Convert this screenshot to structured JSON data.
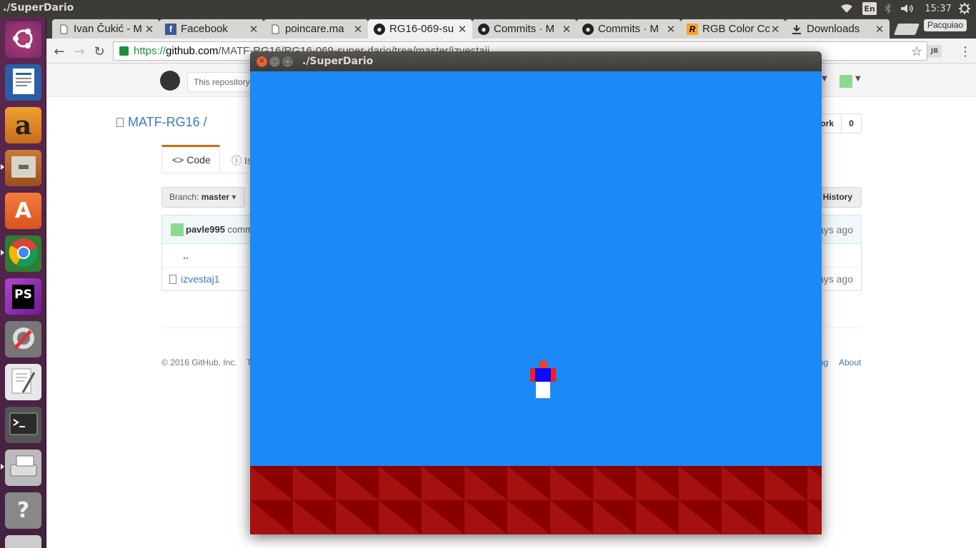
{
  "panel": {
    "window_title": "./SuperDario",
    "keyboard_lang": "En",
    "clock": "15:37"
  },
  "launcher": {
    "items": [
      {
        "name": "dash",
        "icon": "ubuntu-logo-icon",
        "color": "#8a3a7a"
      },
      {
        "name": "libreoffice-writer",
        "icon": "document-writer-icon",
        "color": "#2a5fa5"
      },
      {
        "name": "amazon",
        "icon": "amazon-icon",
        "color": "#c76d1a"
      },
      {
        "name": "files",
        "icon": "file-cabinet-icon",
        "color": "#b5652a"
      },
      {
        "name": "software-center",
        "icon": "shopping-bag-icon",
        "color": "#e5622b"
      },
      {
        "name": "chrome",
        "icon": "chrome-icon",
        "color": "#4a8a4a"
      },
      {
        "name": "phpstorm",
        "icon": "phpstorm-icon",
        "color": "#7a2c8a"
      },
      {
        "name": "system-settings",
        "icon": "settings-wrench-icon",
        "color": "#8a8a8a"
      },
      {
        "name": "text-editor",
        "icon": "text-editor-icon",
        "color": "#e0e0e0"
      },
      {
        "name": "terminal",
        "icon": "terminal-icon",
        "color": "#3a3a3a"
      },
      {
        "name": "scanner",
        "icon": "scanner-icon",
        "color": "#b0b0b0"
      },
      {
        "name": "help",
        "icon": "help-icon",
        "color": "#7a7a7a"
      },
      {
        "name": "document",
        "icon": "document-icon",
        "color": "#c0c0c0"
      }
    ]
  },
  "browser": {
    "tabs": [
      {
        "label": "Ivan Čukić - M",
        "icon": "page-icon"
      },
      {
        "label": "Facebook",
        "icon": "facebook-icon"
      },
      {
        "label": "poincare.ma",
        "icon": "page-icon"
      },
      {
        "label": "RG16-069-su",
        "icon": "github-icon",
        "active": true
      },
      {
        "label": "Commits · M",
        "icon": "github-icon"
      },
      {
        "label": "Commits · M",
        "icon": "github-icon"
      },
      {
        "label": "RGB Color Co",
        "icon": "rgb-icon"
      },
      {
        "label": "Downloads",
        "icon": "download-icon"
      }
    ],
    "profile_name": "Pacquiao",
    "url_scheme": "https://",
    "url_host": "github.com",
    "url_path": "/MATF-RG16/RG16-069-super-dario/tree/master/izvestaji"
  },
  "github": {
    "search_placeholder": "This repository",
    "repo_owner": "MATF-RG16",
    "repo_sep": " /",
    "fork_label": "Fork",
    "fork_count": "0",
    "tab_code": "Code",
    "tab_issues": "Is",
    "branch_label": "Branch: ",
    "branch_name": "master",
    "history_label": "History",
    "commit_user": "pavle995",
    "commit_text": " comm",
    "commit_time": "ays ago",
    "parent_dir": "..",
    "file_name": "izvestaj1",
    "file_time": "ays ago",
    "footer_copy": "© 2016 GitHub, Inc.",
    "footer_terms": "T",
    "footer_blog": "og",
    "footer_about": "About"
  },
  "game_window": {
    "title": "./SuperDario",
    "sky_color": "#1b8af7",
    "ground_color": "#8a0000",
    "ground_shade": "#a51010"
  }
}
